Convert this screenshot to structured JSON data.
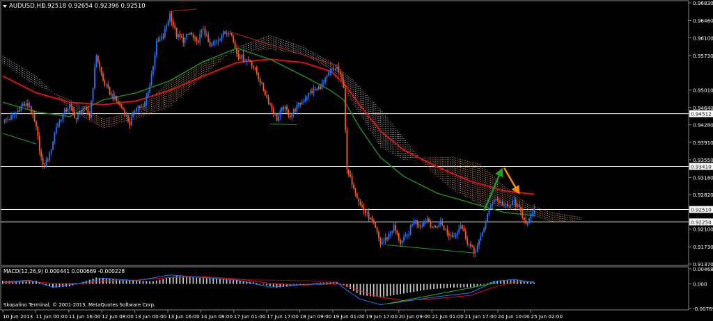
{
  "window": {
    "symbol_label": "AUDUSD,H1",
    "ohlc_text": "0.92518 0.92654 0.92396 0.92510",
    "copyright": "Skopalino Terminal, © 2001-2013, MetaQuotes Software Corp."
  },
  "colors": {
    "background": "#000000",
    "bull": "#1e78ff",
    "bear": "#ff5a1e",
    "ma_fast": "#1f8a1f",
    "ma_slow": "#e01010",
    "cloud_a": "#c0c0c0",
    "cloud_b": "#d8a070",
    "arrow_up": "#20a020",
    "arrow_down": "#ff8c00",
    "macd_hist": "#c8c8c8",
    "macd_line": "#1e78ff",
    "signal_line": "#e01010",
    "macd_trend_up": "#20c020",
    "macd_trend_down": "#c02020"
  },
  "chart_data": [
    {
      "type": "candlestick",
      "title": "AUDUSD,H1",
      "ylim": [
        0.9137,
        0.9683
      ],
      "y_ticks": [
        "0.96830",
        "0.96460",
        "0.96100",
        "0.95730",
        "0.95010",
        "0.94640",
        "0.94280",
        "0.93910",
        "0.93550",
        "0.93180",
        "0.92820",
        "0.92100",
        "0.91730",
        "0.91370"
      ],
      "x_ticks": [
        "10 Jun 2013",
        "11 Jun 00:00",
        "11 Jun 16:00",
        "12 Jun 08:00",
        "13 Jun 00:00",
        "13 Jun 16:00",
        "14 Jun 08:00",
        "17 Jun 01:00",
        "17 Jun 17:00",
        "18 Jun 09:00",
        "19 Jun 01:00",
        "19 Jun 17:00",
        "20 Jun 09:00",
        "21 Jun 01:00",
        "21 Jun 17:00",
        "24 Jun 10:00",
        "25 Jun 02:00"
      ],
      "price_levels": [
        {
          "label": "0.94512",
          "value": 0.94512
        },
        {
          "label": "0.93410",
          "value": 0.9341
        },
        {
          "label": "0.92510",
          "value": 0.9251
        },
        {
          "label": "0.92250",
          "value": 0.9225
        }
      ],
      "price_path": [
        [
          0,
          0.9435
        ],
        [
          6,
          0.9445
        ],
        [
          12,
          0.947
        ],
        [
          16,
          0.9468
        ],
        [
          20,
          0.942
        ],
        [
          24,
          0.9338
        ],
        [
          28,
          0.9365
        ],
        [
          32,
          0.9425
        ],
        [
          36,
          0.945
        ],
        [
          40,
          0.9468
        ],
        [
          44,
          0.944
        ],
        [
          48,
          0.9465
        ],
        [
          52,
          0.9445
        ],
        [
          56,
          0.9575
        ],
        [
          60,
          0.952
        ],
        [
          64,
          0.9495
        ],
        [
          68,
          0.9478
        ],
        [
          72,
          0.946
        ],
        [
          76,
          0.943
        ],
        [
          80,
          0.9468
        ],
        [
          84,
          0.9462
        ],
        [
          88,
          0.9512
        ],
        [
          92,
          0.9598
        ],
        [
          96,
          0.9612
        ],
        [
          100,
          0.966
        ],
        [
          104,
          0.9615
        ],
        [
          108,
          0.9605
        ],
        [
          112,
          0.962
        ],
        [
          116,
          0.9598
        ],
        [
          120,
          0.963
        ],
        [
          124,
          0.959
        ],
        [
          128,
          0.9605
        ],
        [
          132,
          0.9618
        ],
        [
          136,
          0.9625
        ],
        [
          140,
          0.9578
        ],
        [
          144,
          0.9566
        ],
        [
          148,
          0.9562
        ],
        [
          152,
          0.9536
        ],
        [
          156,
          0.9502
        ],
        [
          160,
          0.947
        ],
        [
          164,
          0.944
        ],
        [
          168,
          0.9465
        ],
        [
          172,
          0.9448
        ],
        [
          176,
          0.9465
        ],
        [
          180,
          0.948
        ],
        [
          184,
          0.9496
        ],
        [
          188,
          0.9502
        ],
        [
          192,
          0.9515
        ],
        [
          196,
          0.954
        ],
        [
          200,
          0.9548
        ],
        [
          204,
          0.951
        ],
        [
          206,
          0.933
        ],
        [
          210,
          0.93
        ],
        [
          214,
          0.926
        ],
        [
          218,
          0.924
        ],
        [
          222,
          0.922
        ],
        [
          226,
          0.918
        ],
        [
          230,
          0.9192
        ],
        [
          234,
          0.9215
        ],
        [
          238,
          0.9182
        ],
        [
          242,
          0.9195
        ],
        [
          246,
          0.9228
        ],
        [
          250,
          0.9218
        ],
        [
          254,
          0.9232
        ],
        [
          258,
          0.921
        ],
        [
          262,
          0.9225
        ],
        [
          266,
          0.92
        ],
        [
          270,
          0.9195
        ],
        [
          274,
          0.922
        ],
        [
          278,
          0.9185
        ],
        [
          282,
          0.916
        ],
        [
          286,
          0.919
        ],
        [
          290,
          0.924
        ],
        [
          294,
          0.9275
        ],
        [
          298,
          0.9265
        ],
        [
          302,
          0.9255
        ],
        [
          306,
          0.9268
        ],
        [
          310,
          0.9245
        ],
        [
          314,
          0.922
        ],
        [
          318,
          0.9251
        ]
      ],
      "ma_fast": [
        [
          0,
          0.9475
        ],
        [
          20,
          0.9455
        ],
        [
          40,
          0.9445
        ],
        [
          60,
          0.948
        ],
        [
          80,
          0.9495
        ],
        [
          100,
          0.952
        ],
        [
          120,
          0.956
        ],
        [
          140,
          0.9588
        ],
        [
          160,
          0.9565
        ],
        [
          180,
          0.953
        ],
        [
          196,
          0.95
        ],
        [
          204,
          0.948
        ],
        [
          214,
          0.942
        ],
        [
          226,
          0.936
        ],
        [
          240,
          0.932
        ],
        [
          260,
          0.9285
        ],
        [
          280,
          0.9265
        ],
        [
          300,
          0.9245
        ],
        [
          318,
          0.9238
        ]
      ],
      "ma_slow": [
        [
          0,
          0.953
        ],
        [
          20,
          0.9495
        ],
        [
          40,
          0.9475
        ],
        [
          60,
          0.947
        ],
        [
          80,
          0.9478
        ],
        [
          100,
          0.95
        ],
        [
          120,
          0.953
        ],
        [
          140,
          0.9558
        ],
        [
          160,
          0.9565
        ],
        [
          180,
          0.9558
        ],
        [
          196,
          0.954
        ],
        [
          204,
          0.9515
        ],
        [
          214,
          0.9468
        ],
        [
          226,
          0.9415
        ],
        [
          240,
          0.9375
        ],
        [
          260,
          0.934
        ],
        [
          280,
          0.931
        ],
        [
          300,
          0.929
        ],
        [
          318,
          0.9283
        ]
      ],
      "cloud_span_a": [
        [
          0,
          0.9572
        ],
        [
          20,
          0.953
        ],
        [
          40,
          0.946
        ],
        [
          60,
          0.942
        ],
        [
          80,
          0.944
        ],
        [
          100,
          0.9465
        ],
        [
          120,
          0.953
        ],
        [
          140,
          0.959
        ],
        [
          160,
          0.9615
        ],
        [
          180,
          0.959
        ],
        [
          196,
          0.956
        ],
        [
          210,
          0.952
        ],
        [
          226,
          0.946
        ],
        [
          240,
          0.94
        ],
        [
          256,
          0.933
        ],
        [
          270,
          0.929
        ],
        [
          286,
          0.926
        ],
        [
          300,
          0.9255
        ],
        [
          314,
          0.924
        ],
        [
          328,
          0.9225
        ],
        [
          346,
          0.9228
        ]
      ],
      "cloud_span_b": [
        [
          0,
          0.9555
        ],
        [
          20,
          0.951
        ],
        [
          40,
          0.948
        ],
        [
          60,
          0.944
        ],
        [
          80,
          0.9455
        ],
        [
          100,
          0.952
        ],
        [
          120,
          0.956
        ],
        [
          140,
          0.958
        ],
        [
          160,
          0.9585
        ],
        [
          180,
          0.9575
        ],
        [
          196,
          0.9545
        ],
        [
          210,
          0.947
        ],
        [
          226,
          0.938
        ],
        [
          240,
          0.9355
        ],
        [
          256,
          0.936
        ],
        [
          270,
          0.936
        ],
        [
          286,
          0.9345
        ],
        [
          300,
          0.93
        ],
        [
          314,
          0.9262
        ],
        [
          328,
          0.9245
        ],
        [
          346,
          0.9235
        ]
      ],
      "trendlines": [
        {
          "color": "#20a020",
          "points": [
            [
              0,
              0.941
            ],
            [
              20,
              0.9388
            ]
          ]
        },
        {
          "color": "#20a020",
          "points": [
            [
              160,
              0.943
            ],
            [
              176,
              0.9428
            ]
          ]
        },
        {
          "color": "#20a020",
          "points": [
            [
              230,
              0.9177
            ],
            [
              282,
              0.916
            ]
          ]
        },
        {
          "color": "#c02020",
          "points": [
            [
              100,
              0.9665
            ],
            [
              116,
              0.967
            ]
          ]
        },
        {
          "color": "#c02020",
          "points": [
            [
              136,
              0.9622
            ],
            [
              200,
              0.9552
            ]
          ]
        }
      ],
      "forecast": [
        {
          "color": "#20a020",
          "points": [
            [
              288,
              0.9248
            ],
            [
              298,
              0.933
            ]
          ]
        },
        {
          "color": "#ff8c00",
          "points": [
            [
              300,
              0.9338
            ],
            [
              308,
              0.929
            ]
          ]
        }
      ]
    },
    {
      "type": "bar",
      "title": "MACD(12,26,9) 0.000441 0.000669 -0.000228",
      "ylim": [
        -0.007695,
        0.004687
      ],
      "y_ticks": [
        "0.004687",
        "0.000",
        "-0.007695"
      ],
      "histogram": [
        [
          0,
          0.0009
        ],
        [
          20,
          0.001
        ],
        [
          30,
          -0.0012
        ],
        [
          40,
          -0.0008
        ],
        [
          56,
          0.002
        ],
        [
          70,
          0.0012
        ],
        [
          90,
          0.0008
        ],
        [
          104,
          0.0025
        ],
        [
          120,
          0.0018
        ],
        [
          136,
          0.0014
        ],
        [
          150,
          0.0005
        ],
        [
          164,
          -0.0012
        ],
        [
          176,
          -0.0005
        ],
        [
          190,
          0.0004
        ],
        [
          200,
          0.0006
        ],
        [
          206,
          -0.001
        ],
        [
          214,
          -0.0035
        ],
        [
          226,
          -0.0042
        ],
        [
          240,
          -0.003
        ],
        [
          254,
          -0.0018
        ],
        [
          268,
          -0.0012
        ],
        [
          282,
          -0.001
        ],
        [
          294,
          0.0008
        ],
        [
          306,
          0.0012
        ],
        [
          318,
          0.0004
        ]
      ],
      "macd_line": [
        [
          0,
          0.0005
        ],
        [
          16,
          0.0012
        ],
        [
          30,
          -0.001
        ],
        [
          48,
          0.0004
        ],
        [
          60,
          0.0018
        ],
        [
          80,
          0.001
        ],
        [
          100,
          0.0028
        ],
        [
          120,
          0.002
        ],
        [
          140,
          0.0012
        ],
        [
          160,
          -0.001
        ],
        [
          180,
          -0.0002
        ],
        [
          200,
          0.0004
        ],
        [
          206,
          -0.002
        ],
        [
          214,
          -0.0048
        ],
        [
          226,
          -0.0065
        ],
        [
          240,
          -0.0055
        ],
        [
          260,
          -0.004
        ],
        [
          280,
          -0.0028
        ],
        [
          294,
          0.0008
        ],
        [
          306,
          0.0014
        ],
        [
          318,
          0.0004
        ]
      ],
      "signal_line": [
        [
          0,
          0.0004
        ],
        [
          16,
          0.0008
        ],
        [
          30,
          0.0002
        ],
        [
          48,
          0.0001
        ],
        [
          60,
          0.001
        ],
        [
          80,
          0.0012
        ],
        [
          100,
          0.002
        ],
        [
          120,
          0.0022
        ],
        [
          140,
          0.0016
        ],
        [
          160,
          0.0002
        ],
        [
          180,
          -0.0004
        ],
        [
          200,
          0.0
        ],
        [
          206,
          -0.0006
        ],
        [
          214,
          -0.0022
        ],
        [
          226,
          -0.0042
        ],
        [
          240,
          -0.0052
        ],
        [
          260,
          -0.0046
        ],
        [
          280,
          -0.0036
        ],
        [
          294,
          -0.001
        ],
        [
          306,
          0.0006
        ],
        [
          318,
          0.0007
        ]
      ]
    }
  ]
}
